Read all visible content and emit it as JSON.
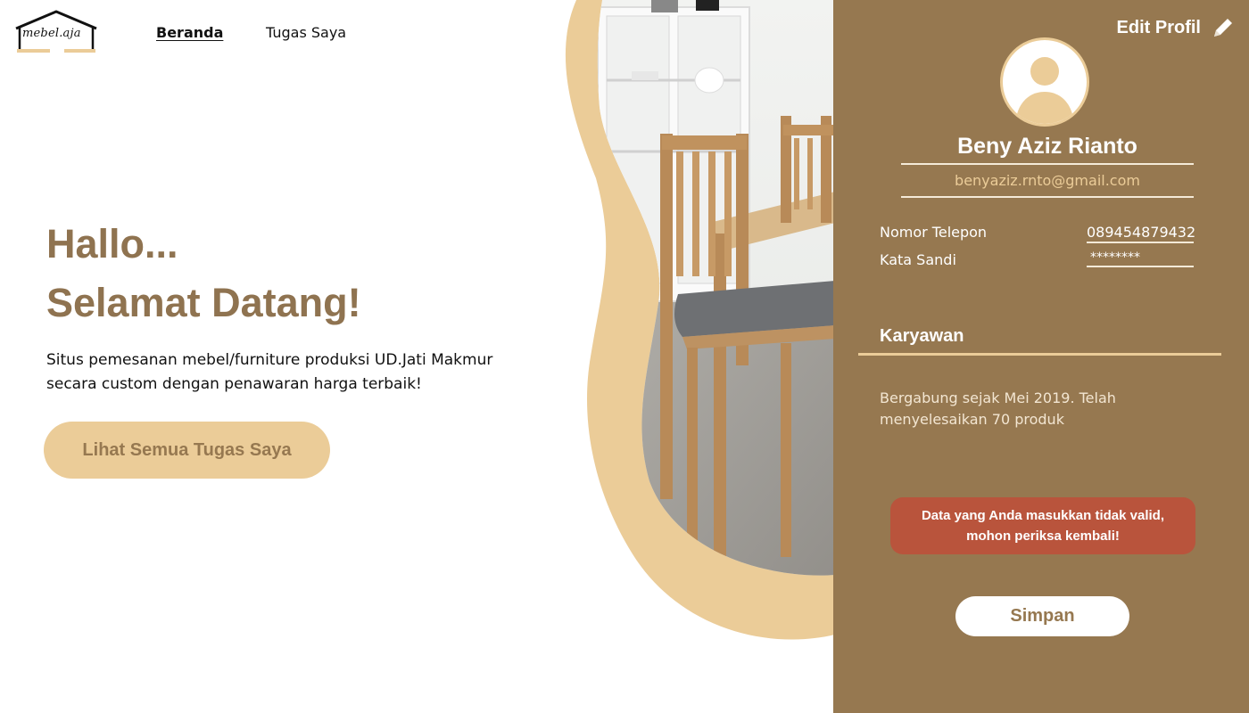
{
  "brand": {
    "logo_text": "mebel.aja",
    "logo_icon": "house-outline-icon"
  },
  "nav": {
    "items": [
      {
        "label": "Beranda",
        "active": true
      },
      {
        "label": "Tugas Saya",
        "active": false
      }
    ]
  },
  "hero": {
    "greeting": "Hallo...",
    "welcome": "Selamat Datang!",
    "description": "Situs  pemesanan mebel/furniture produksi UD.Jati Makmur secara custom dengan penawaran harga terbaik!",
    "cta_label": "Lihat Semua Tugas Saya"
  },
  "profile": {
    "edit_label": "Edit Profil",
    "edit_icon": "pencil-icon",
    "name": "Beny Aziz Rianto",
    "email": "benyaziz.rnto@gmail.com",
    "phone_label": "Nomor Telepon",
    "phone_value": "089454879432",
    "password_label": "Kata Sandi",
    "password_value": "********",
    "role": "Karyawan",
    "bio": "Bergabung sejak Mei 2019. Telah menyelesaikan 70 produk",
    "error_message": "Data yang Anda masukkan tidak valid, mohon periksa kembali!",
    "save_label": "Simpan"
  },
  "colors": {
    "brown": "#967850",
    "cream": "#ebcc98",
    "error": "#b9543c",
    "hero_text": "#8f7350"
  }
}
